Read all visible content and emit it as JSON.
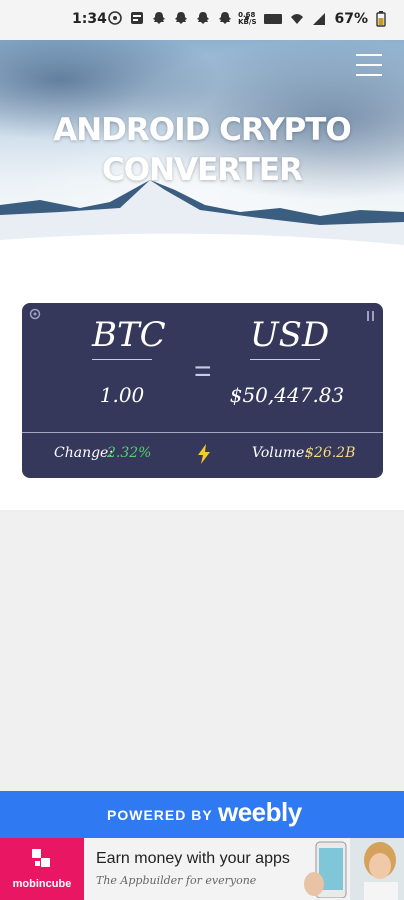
{
  "status_bar": {
    "time": "1:34",
    "network_speed": "0.68\nKB/S",
    "battery": "67%"
  },
  "hero": {
    "title": "ANDROID CRYPTO CONVERTER"
  },
  "converter": {
    "from_currency": "BTC",
    "to_currency": "USD",
    "equals_symbol": "=",
    "from_amount": "1.00",
    "to_amount": "$50,447.83",
    "change_label": "Change:",
    "change_value": "2.32%",
    "volume_label": "Volume:",
    "volume_value": "$26.2B",
    "colors": {
      "card": "#35385b",
      "change": "#53cf70",
      "volume": "#f5d97a"
    }
  },
  "footer_banner": {
    "prefix": "POWERED BY",
    "brand": "weebly",
    "color": "#2f79f2"
  },
  "ad": {
    "logo_text": "mobincube",
    "title": "Earn money with your apps",
    "subtitle": "The Appbuilder for everyone",
    "logo_color": "#e91763"
  }
}
